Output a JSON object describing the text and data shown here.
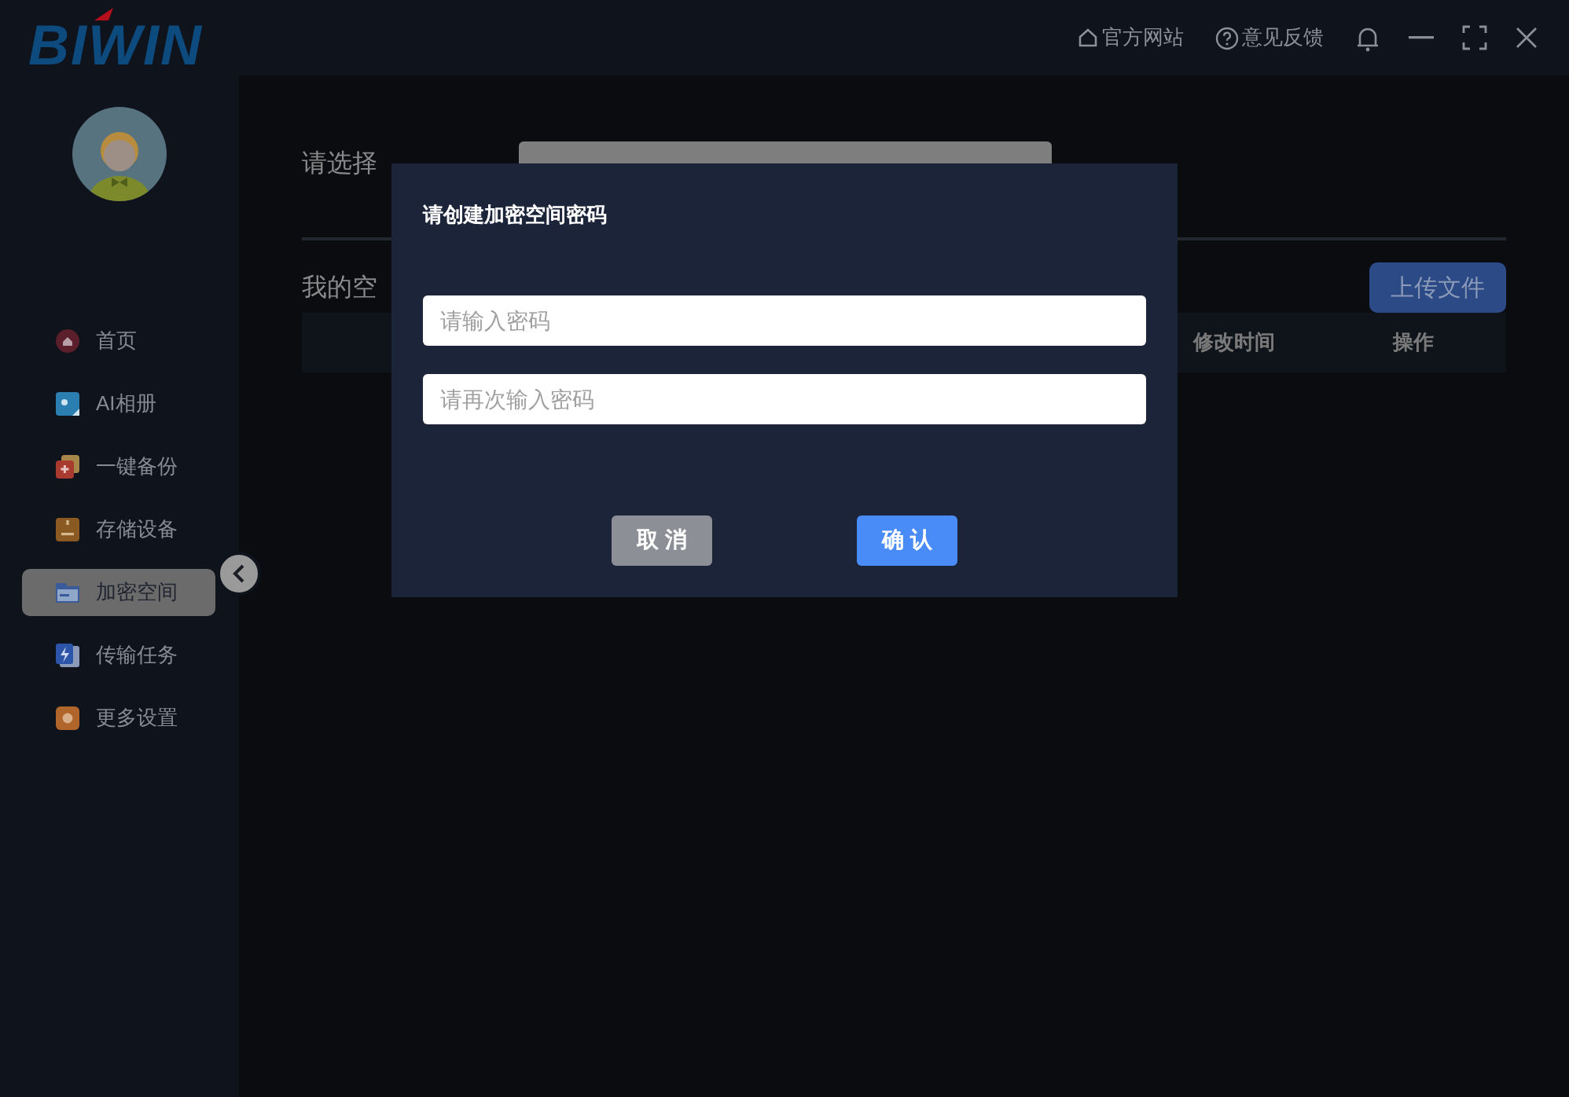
{
  "app": {
    "logo": "BIWIN"
  },
  "title_bar": {
    "links": [
      {
        "kind": "home",
        "label": "官方网站"
      },
      {
        "kind": "help",
        "label": "意见反馈"
      }
    ],
    "controls": [
      {
        "kind": "bell"
      },
      {
        "kind": "minimize"
      },
      {
        "kind": "maximize"
      },
      {
        "kind": "close"
      }
    ]
  },
  "sidebar": {
    "items": [
      {
        "label": "首页",
        "selected": false
      },
      {
        "label": "AI相册",
        "selected": false
      },
      {
        "label": "一键备份",
        "selected": false
      },
      {
        "label": "存储设备",
        "selected": false
      },
      {
        "label": "加密空间",
        "selected": true
      },
      {
        "label": "传输任务",
        "selected": false
      },
      {
        "label": "更多设置",
        "selected": false
      }
    ]
  },
  "content": {
    "path_label": "请选择",
    "section_title": "我的空",
    "upload_button": "上传文件",
    "table": {
      "columns": [
        "修改时间",
        "操作"
      ]
    }
  },
  "dialog": {
    "title": "请创建加密空间密码",
    "fields": [
      {
        "placeholder": "请输入密码"
      },
      {
        "placeholder": "请再次输入密码"
      }
    ],
    "buttons": [
      {
        "kind": "secondary",
        "label": "取 消"
      },
      {
        "kind": "primary",
        "label": "确 认"
      }
    ]
  }
}
